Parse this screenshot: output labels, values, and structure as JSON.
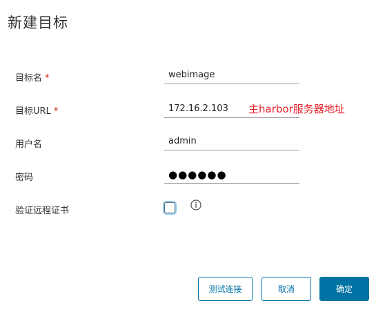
{
  "dialog": {
    "title": "新建目标"
  },
  "form": {
    "name": {
      "label": "目标名",
      "required_mark": "*",
      "value": "webimage"
    },
    "url": {
      "label": "目标URL",
      "required_mark": "*",
      "value": "172.16.2.103"
    },
    "username": {
      "label": "用户名",
      "value": "admin"
    },
    "password": {
      "label": "密码",
      "value": "●●●●●●"
    },
    "verify_cert": {
      "label": "验证远程证书",
      "checked": false
    }
  },
  "annotation": {
    "text": "主harbor服务器地址",
    "color": "#e8202a"
  },
  "buttons": {
    "test_label": "测试连接",
    "cancel_label": "取消",
    "ok_label": "确定"
  },
  "icons": {
    "info": "info-circle-icon"
  },
  "colors": {
    "primary": "#0072a3",
    "required": "#c92100",
    "focus_ring": "#8ec9f0"
  }
}
